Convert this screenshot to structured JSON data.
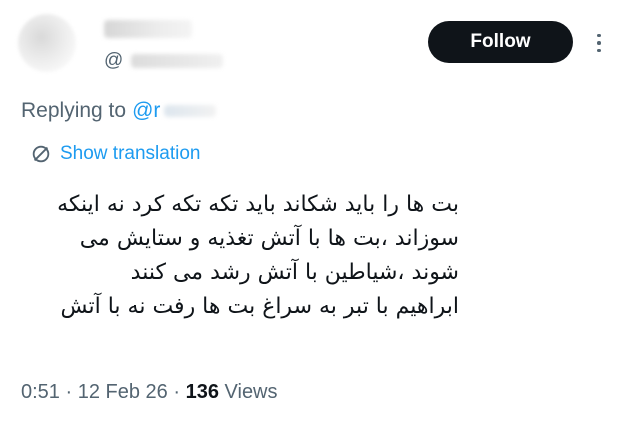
{
  "header": {
    "handle_prefix": "@",
    "follow_label": "Follow"
  },
  "reply": {
    "prefix": "Replying to",
    "handle": "@r"
  },
  "translation": {
    "label": "Show translation"
  },
  "tweet": {
    "lines": [
      "بت ها را باید شکاند باید تکه تکه کرد نه اینکه",
      "سوزاند ،بت ها با آتش تغذیه و ستایش می",
      "شوند ،شیاطین با آتش رشد می کنند",
      "ابراهیم با تبر به سراغ بت ها رفت نه با آتش"
    ]
  },
  "meta": {
    "time": "0:51",
    "separator": " · ",
    "date": "12 Feb 26",
    "views_count": "136",
    "views_label": "Views"
  },
  "colors": {
    "text": "#0f1419",
    "secondary": "#536471",
    "link": "#1d9bf0",
    "follow_bg": "#0f1419"
  },
  "icons": {
    "more": "more-vertical-icon",
    "translate": "translate-globe-icon"
  }
}
